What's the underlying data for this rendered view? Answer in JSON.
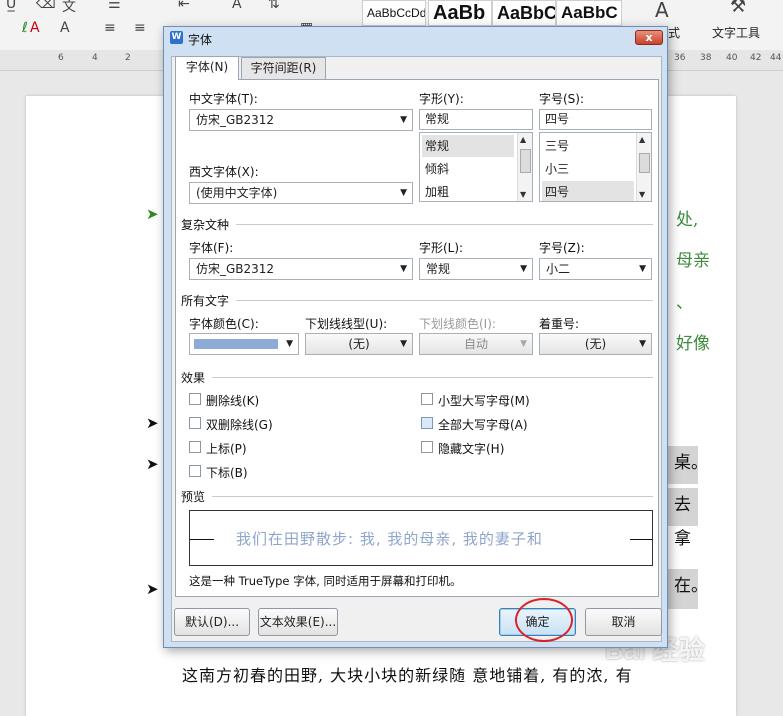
{
  "ribbon": {
    "style_samples": [
      "AaBbCcDd",
      "AaBb",
      "AaBbC",
      "AaBbC"
    ],
    "text_tools_label": "文字工具",
    "style_fragment": "式"
  },
  "ruler": {
    "ticks": [
      "6",
      "4",
      "2",
      "36",
      "38",
      "40",
      "42",
      "44"
    ]
  },
  "document": {
    "side_text": [
      "处,",
      "母亲",
      "、",
      "好像"
    ],
    "gray_blocks": [
      "桌。",
      "去拿",
      "在。"
    ],
    "body_line": "这南方初春的田野, 大块小块的新绿随 意地铺着, 有的浓, 有",
    "watermark": "Bai 经验"
  },
  "dialog": {
    "title": "字体",
    "close_glyph": "x",
    "tabs": [
      {
        "label": "字体(N)",
        "active": true
      },
      {
        "label": "字符间距(R)",
        "active": false
      }
    ],
    "chinese_font": {
      "label": "中文字体(T):",
      "value": "仿宋_GB2312"
    },
    "western_font": {
      "label": "西文字体(X):",
      "value": "(使用中文字体)"
    },
    "style": {
      "label": "字形(Y):",
      "value": "常规",
      "options": [
        "常规",
        "倾斜",
        "加粗"
      ],
      "selected": "常规"
    },
    "size": {
      "label": "字号(S):",
      "value": "四号",
      "options": [
        "三号",
        "小三",
        "四号"
      ],
      "selected": "四号"
    },
    "complex": {
      "group_label": "复杂文种",
      "font_label": "字体(F):",
      "font_value": "仿宋_GB2312",
      "style_label": "字形(L):",
      "style_value": "常规",
      "size_label": "字号(Z):",
      "size_value": "小二"
    },
    "all_text": {
      "group_label": "所有文字",
      "font_color_label": "字体颜色(C):",
      "font_color": "#8eaad6",
      "underline_type_label": "下划线线型(U):",
      "underline_type_value": "(无)",
      "underline_color_label": "下划线颜色(I):",
      "underline_color_value": "自动",
      "emphasis_label": "着重号:",
      "emphasis_value": "(无)"
    },
    "effects": {
      "group_label": "效果",
      "strikethrough": "删除线(K)",
      "double_strikethrough": "双删除线(G)",
      "superscript": "上标(P)",
      "subscript": "下标(B)",
      "small_caps": "小型大写字母(M)",
      "all_caps": "全部大写字母(A)",
      "hidden": "隐藏文字(H)"
    },
    "preview": {
      "group_label": "预览",
      "sample_text": "我们在田野散步: 我, 我的母亲, 我的妻子和",
      "note": "这是一种 TrueType 字体, 同时适用于屏幕和打印机。"
    },
    "buttons": {
      "default": "默认(D)...",
      "text_effects": "文本效果(E)...",
      "ok": "确定",
      "cancel": "取消"
    }
  }
}
